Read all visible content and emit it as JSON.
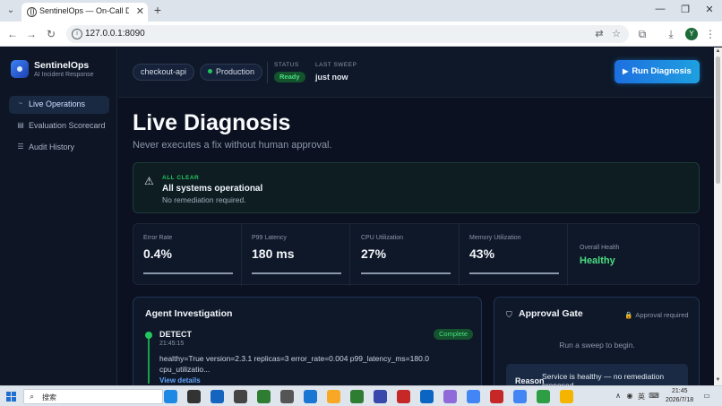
{
  "browser": {
    "tab_title": "SentinelOps — On-Call Diagnosis",
    "url": "127.0.0.1:8090",
    "profile_initial": "Y",
    "new_tab_glyph": "+",
    "tab_close_glyph": "✕",
    "win_min": "—",
    "win_max": "❐",
    "win_close": "✕",
    "back_glyph": "←",
    "forward_glyph": "→",
    "reload_glyph": "↻",
    "translate_glyph": "⇄",
    "star_glyph": "☆",
    "extensions_glyph": "⧉",
    "download_glyph": "⤓",
    "menu_glyph": "⋮",
    "tab_search_glyph": "⌄"
  },
  "brand": {
    "name": "SentinelOps",
    "subtitle": "AI Incident Response"
  },
  "sidebar": {
    "items": [
      {
        "label": "Live Operations",
        "icon": "activity-icon",
        "glyph": "~",
        "active": true
      },
      {
        "label": "Evaluation Scorecard",
        "icon": "scorecard-icon",
        "glyph": "▤",
        "active": false
      },
      {
        "label": "Audit History",
        "icon": "history-icon",
        "glyph": "☰",
        "active": false
      }
    ]
  },
  "topbar": {
    "service": "checkout-api",
    "environment": "Production",
    "status_label": "STATUS",
    "status_value": "Ready",
    "sweep_label": "LAST SWEEP",
    "sweep_value": "just now",
    "run_button": "Run Diagnosis",
    "run_glyph": "▶"
  },
  "page": {
    "title": "Live Diagnosis",
    "subtitle": "Never executes a fix without human approval."
  },
  "alert": {
    "tag": "ALL CLEAR",
    "title": "All systems operational",
    "description": "No remediation required.",
    "icon_glyph": "⚠"
  },
  "metrics": [
    {
      "label": "Error Rate",
      "value": "0.4%",
      "bar_fraction": 1.0
    },
    {
      "label": "P99 Latency",
      "value": "180 ms",
      "bar_fraction": 1.0
    },
    {
      "label": "CPU Utilization",
      "value": "27%",
      "bar_fraction": 1.0
    },
    {
      "label": "Memory Utilization",
      "value": "43%",
      "bar_fraction": 1.0
    }
  ],
  "overall_health": {
    "label": "Overall Health",
    "value": "Healthy"
  },
  "investigation": {
    "title": "Agent Investigation",
    "step": {
      "name": "DETECT",
      "time": "21:45:15",
      "badge": "Complete",
      "log": "healthy=True version=2.3.1 replicas=3 error_rate=0.004 p99_latency_ms=180.0 cpu_utilizatio...",
      "link": "View details"
    }
  },
  "approval": {
    "title": "Approval Gate",
    "status": "Approval required",
    "shield_glyph": "⛉",
    "lock_glyph": "🔒",
    "prompt": "Run a sweep to begin.",
    "reason_label": "Reason",
    "reason_text": "Service is healthy — no remediation proposed."
  },
  "taskbar": {
    "search_placeholder": "搜索",
    "search_glyph": "⌕",
    "time": "21:45",
    "date": "2026/7/18",
    "ime": "英",
    "tray_chevron": "∧",
    "notification_glyph": "▭",
    "app_colors": [
      "#1e88e5",
      "#333333",
      "#1565c0",
      "#444444",
      "#2e7d32",
      "#555555",
      "#1976d2",
      "#f9a825",
      "#2e7d32",
      "#3949ab",
      "#c62828",
      "#0a66c2",
      "#8e6bd8",
      "#4285f4",
      "#c62828",
      "#4285f4",
      "#2e9e44",
      "#f4b400"
    ]
  }
}
